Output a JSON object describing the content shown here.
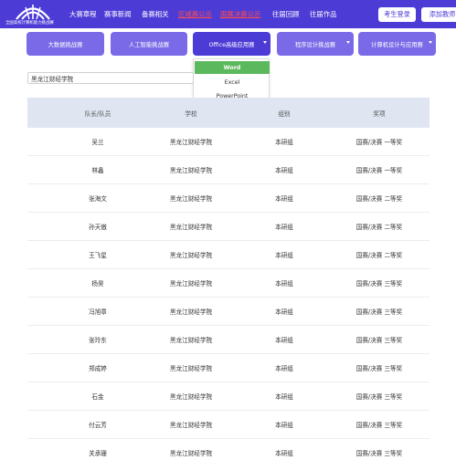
{
  "header": {
    "logo_text": "全国高校计算机能力挑战赛",
    "nav": [
      "大赛章程",
      "赛事新闻",
      "备赛相关",
      "区域赛公示",
      "国赛决赛公示",
      "往届回顾",
      "往届作品"
    ],
    "login_label": "考生登录",
    "teacher_label": "添加教师"
  },
  "categories": [
    "大数据挑战赛",
    "人工智能挑战赛",
    "Office高级应用赛",
    "程序设计挑战赛",
    "计算机设计与应用赛"
  ],
  "dropdown": {
    "options": [
      "Word",
      "Excel",
      "PowerPoint"
    ],
    "selected": "Word"
  },
  "school_select": {
    "value": "黑龙江财经学院"
  },
  "table": {
    "headers": [
      "队长/队员",
      "学校",
      "组别",
      "奖项"
    ],
    "rows": [
      [
        "吴兰",
        "黑龙江财经学院",
        "本研组",
        "国赛/决赛 一等奖"
      ],
      [
        "林鑫",
        "黑龙江财经学院",
        "本研组",
        "国赛/决赛 一等奖"
      ],
      [
        "张海文",
        "黑龙江财经学院",
        "本研组",
        "国赛/决赛 二等奖"
      ],
      [
        "孙天傲",
        "黑龙江财经学院",
        "本研组",
        "国赛/决赛 二等奖"
      ],
      [
        "王飞星",
        "黑龙江财经学院",
        "本研组",
        "国赛/决赛 二等奖"
      ],
      [
        "杨昊",
        "黑龙江财经学院",
        "本研组",
        "国赛/决赛 三等奖"
      ],
      [
        "冯旭章",
        "黑龙江财经学院",
        "本研组",
        "国赛/决赛 三等奖"
      ],
      [
        "张玲东",
        "黑龙江财经学院",
        "本研组",
        "国赛/决赛 三等奖"
      ],
      [
        "郑成婷",
        "黑龙江财经学院",
        "本研组",
        "国赛/决赛 三等奖"
      ],
      [
        "石金",
        "黑龙江财经学院",
        "本研组",
        "国赛/决赛 三等奖"
      ],
      [
        "付云芳",
        "黑龙江财经学院",
        "本研组",
        "国赛/决赛 三等奖"
      ],
      [
        "关承珊",
        "黑龙江财经学院",
        "本研组",
        "国赛/决赛 三等奖"
      ]
    ]
  },
  "colors": {
    "header_bg": "#4d3bd6",
    "category_bg": "#7a6ae8",
    "highlight_red": "#ff4c4c",
    "dropdown_selected": "#5cb85c",
    "table_header_bg": "#dfe6f2"
  }
}
